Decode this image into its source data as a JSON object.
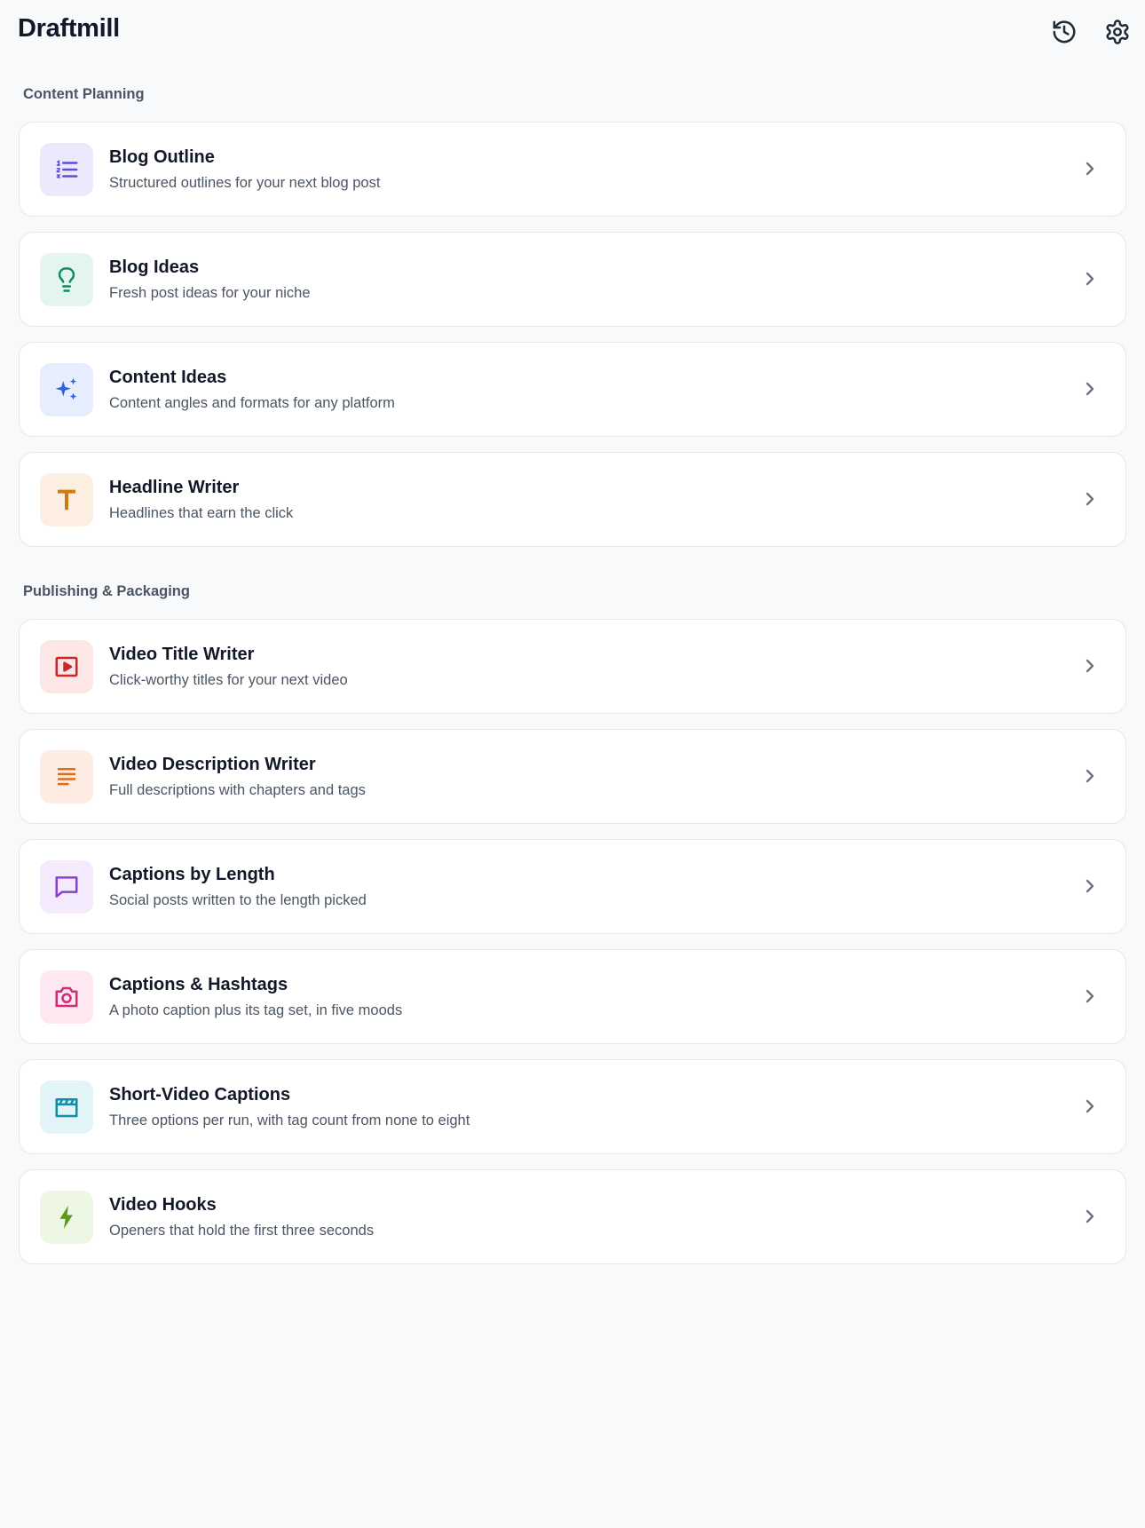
{
  "app": {
    "title": "Draftmill"
  },
  "header": {
    "history_icon": "history-icon",
    "settings_icon": "gear-icon"
  },
  "sections": [
    {
      "title": "Content Planning",
      "items": [
        {
          "title": "Blog Outline",
          "description": "Structured outlines for your next blog post",
          "icon": "list-icon",
          "color": "#5b4fd6",
          "bg": "#ede9fd"
        },
        {
          "title": "Blog Ideas",
          "description": "Fresh post ideas for your niche",
          "icon": "lightbulb-icon",
          "color": "#0f8a6a",
          "bg": "#e3f5ee"
        },
        {
          "title": "Content Ideas",
          "description": "Content angles and formats for any platform",
          "icon": "sparkles-icon",
          "color": "#2f63d6",
          "bg": "#e6edfc"
        },
        {
          "title": "Headline Writer",
          "description": "Headlines that earn the click",
          "icon": "text-icon",
          "color": "#d07a12",
          "bg": "#fcefe1"
        }
      ]
    },
    {
      "title": "Publishing & Packaging",
      "items": [
        {
          "title": "Video Title Writer",
          "description": "Click-worthy titles for your next video",
          "icon": "video-play-icon",
          "color": "#c9282a",
          "bg": "#fce6e6"
        },
        {
          "title": "Video Description Writer",
          "description": "Full descriptions with chapters and tags",
          "icon": "align-left-icon",
          "color": "#de6a1c",
          "bg": "#fdece2"
        },
        {
          "title": "Captions by Length",
          "description": "Social posts written to the length picked",
          "icon": "message-icon",
          "color": "#8a3fd6",
          "bg": "#f3eafd"
        },
        {
          "title": "Captions & Hashtags",
          "description": "A photo caption plus its tag set, in five moods",
          "icon": "camera-icon",
          "color": "#d42a77",
          "bg": "#fde7f0"
        },
        {
          "title": "Short-Video Captions",
          "description": "Three options per run, with tag count from none to eight",
          "icon": "clapperboard-icon",
          "color": "#0e8fa8",
          "bg": "#e2f4f8"
        },
        {
          "title": "Video Hooks",
          "description": "Openers that hold the first three seconds",
          "icon": "bolt-icon",
          "color": "#5a9a1e",
          "bg": "#eef6e4"
        }
      ]
    }
  ]
}
